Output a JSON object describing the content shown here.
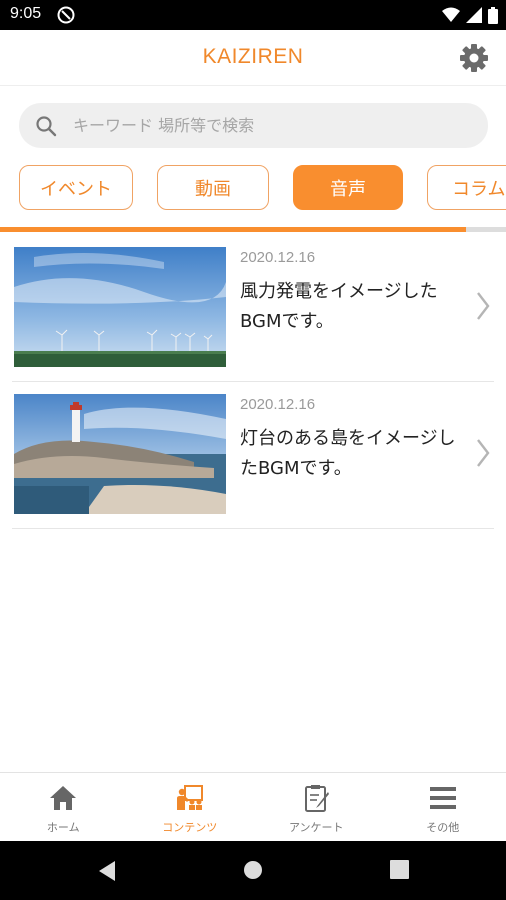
{
  "status_bar": {
    "time": "9:05"
  },
  "header": {
    "title": "KAIZIREN"
  },
  "search": {
    "placeholder": "キーワード 場所等で検索"
  },
  "tabs": [
    {
      "label": "イベント"
    },
    {
      "label": "動画"
    },
    {
      "label": "音声",
      "active": true
    },
    {
      "label": "コラム"
    }
  ],
  "scroll_progress": 0.92,
  "items": [
    {
      "date": "2020.12.16",
      "text": "風力発電をイメージしたBGMです。",
      "thumbnail": "wind-turbines"
    },
    {
      "date": "2020.12.16",
      "text": "灯台のある島をイメージしたBGMです。",
      "thumbnail": "lighthouse"
    }
  ],
  "bottom_nav": [
    {
      "label": "ホーム",
      "icon": "home-icon"
    },
    {
      "label": "コンテンツ",
      "icon": "contents-icon",
      "active": true
    },
    {
      "label": "アンケート",
      "icon": "survey-icon"
    },
    {
      "label": "その他",
      "icon": "menu-icon"
    }
  ],
  "colors": {
    "accent": "#f98e2f",
    "accent_text": "#f0882b"
  }
}
